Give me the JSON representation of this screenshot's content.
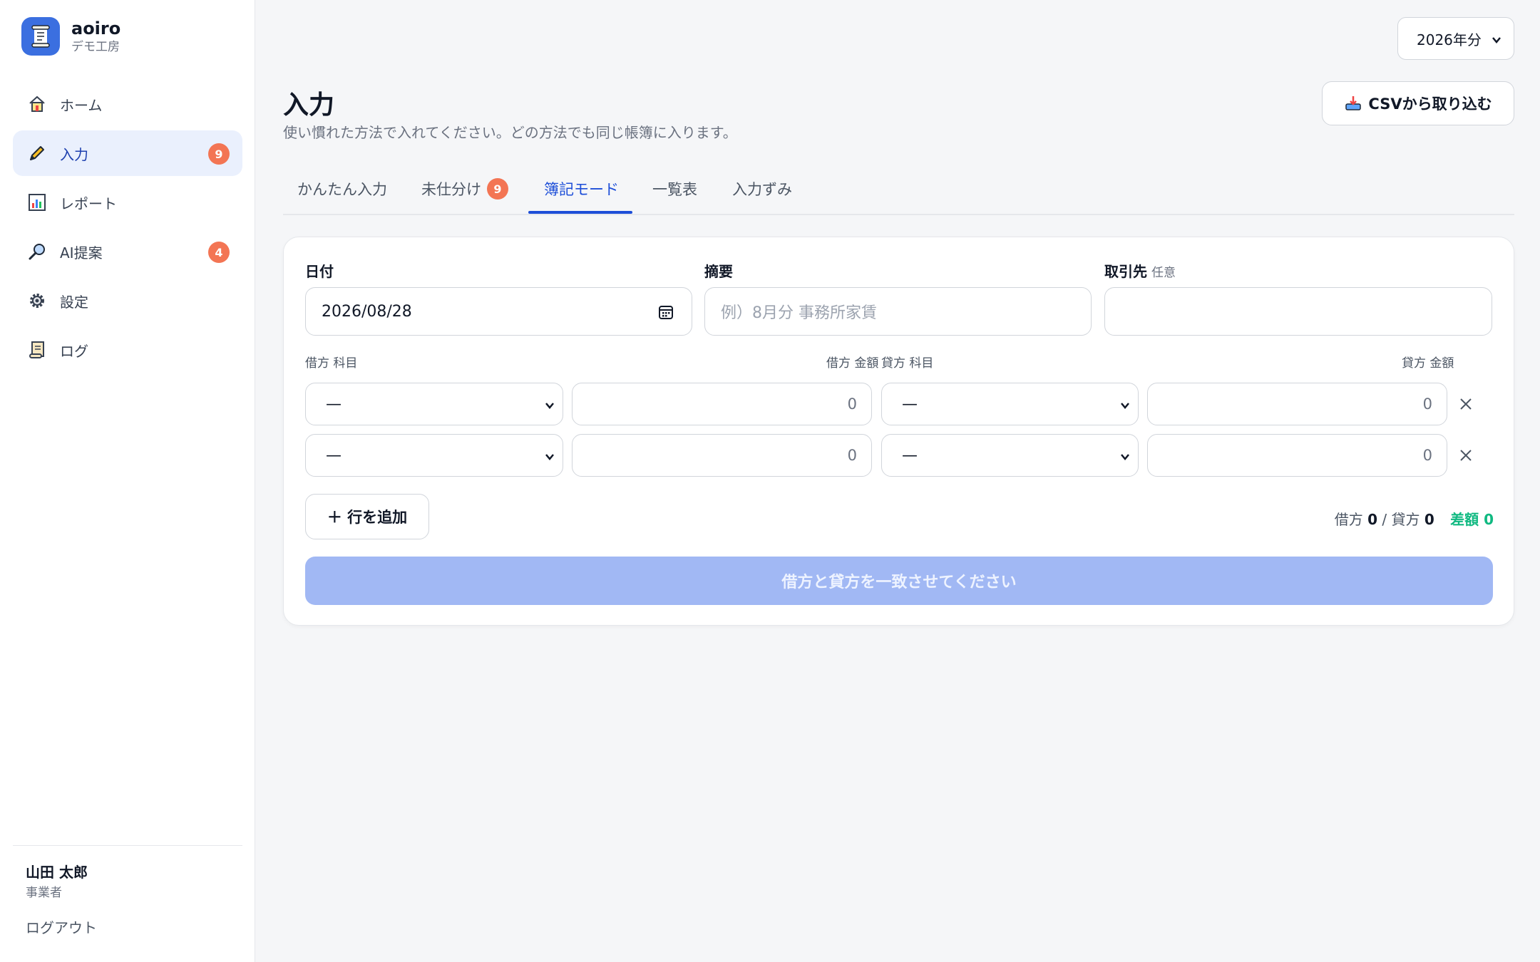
{
  "brand": {
    "name": "aoiro",
    "subtitle": "デモ工房"
  },
  "nav": {
    "items": [
      {
        "label": "ホーム",
        "icon": "house-icon"
      },
      {
        "label": "入力",
        "icon": "pencil-icon",
        "badge": "9",
        "active": true
      },
      {
        "label": "レポート",
        "icon": "bar-chart-icon"
      },
      {
        "label": "AI提案",
        "icon": "magnifier-icon",
        "badge": "4"
      },
      {
        "label": "設定",
        "icon": "gear-icon"
      },
      {
        "label": "ログ",
        "icon": "scroll-icon"
      }
    ]
  },
  "user": {
    "name": "山田 太郎",
    "role": "事業者",
    "logout_label": "ログアウト"
  },
  "header": {
    "year": "2026年分",
    "title": "入力",
    "description": "使い慣れた方法で入れてください。どの方法でも同じ帳簿に入ります。",
    "csv_button": "CSVから取り込む"
  },
  "tabs": [
    {
      "label": "かんたん入力"
    },
    {
      "label": "未仕分け",
      "badge": "9"
    },
    {
      "label": "簿記モード",
      "active": true
    },
    {
      "label": "一覧表"
    },
    {
      "label": "入力ずみ"
    }
  ],
  "form": {
    "date_label": "日付",
    "date_value": "2026/08/28",
    "summary_label": "摘要",
    "summary_placeholder": "例）8月分 事務所家賃",
    "partner_label": "取引先",
    "partner_optional": "任意",
    "partner_value": "",
    "col_debit_account": "借方 科目",
    "col_debit_amount": "借方 金額",
    "col_credit_account": "貸方 科目",
    "col_credit_amount": "貸方 金額",
    "rows": [
      {
        "debit_account": "—",
        "debit_amount": "0",
        "credit_account": "—",
        "credit_amount": "0"
      },
      {
        "debit_account": "—",
        "debit_amount": "0",
        "credit_account": "—",
        "credit_amount": "0"
      }
    ],
    "add_row_label": "＋ 行を追加",
    "totals": {
      "debit_label": "借方",
      "debit_value": "0",
      "separator": "/",
      "credit_label": "貸方",
      "credit_value": "0",
      "diff_label": "差額",
      "diff_value": "0"
    },
    "submit_label": "借方と貸方を一致させてください"
  },
  "colors": {
    "accent": "#1d4ed8",
    "badge": "#f37554",
    "diff": "#10b981",
    "submit_disabled": "#a1b8f4"
  }
}
